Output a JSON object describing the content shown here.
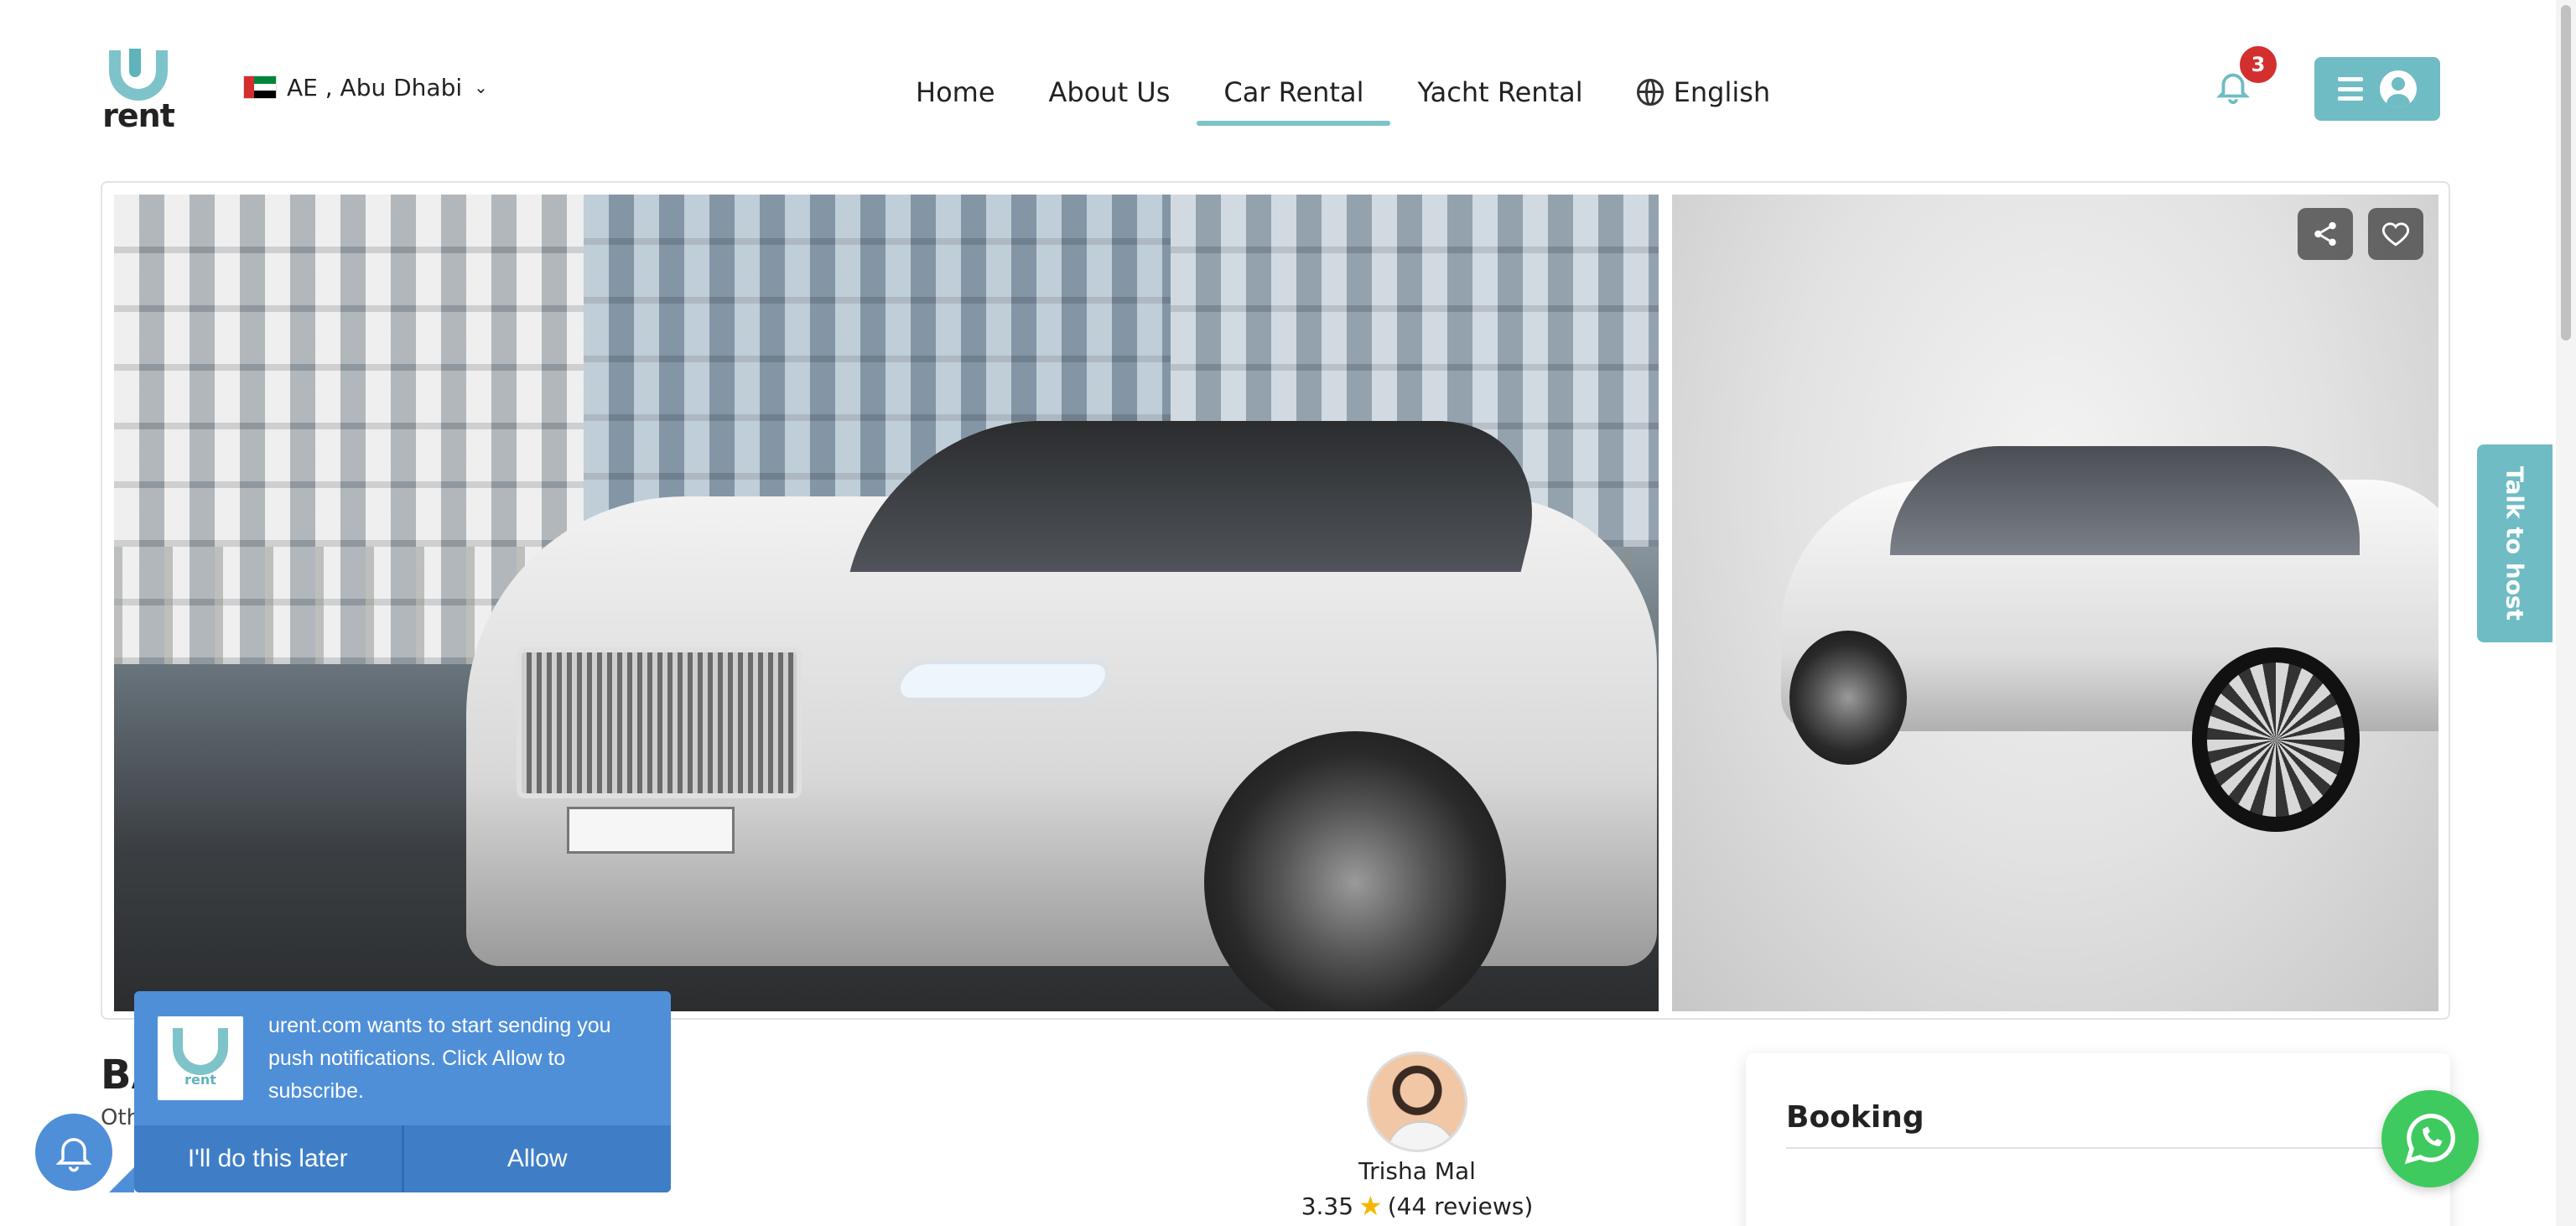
{
  "brand": {
    "logo_text": "rent"
  },
  "location": {
    "label": "AE , Abu Dhabi"
  },
  "nav": {
    "items": [
      {
        "label": "Home",
        "active": false
      },
      {
        "label": "About Us",
        "active": false
      },
      {
        "label": "Car Rental",
        "active": true
      },
      {
        "label": "Yacht Rental",
        "active": false
      }
    ],
    "language": "English"
  },
  "notifications": {
    "count": "3"
  },
  "colors": {
    "accent": "#6fbcc4",
    "badge": "#d32f2f",
    "push": "#4f8fd8",
    "whatsapp": "#3fca5f"
  },
  "gallery": {
    "share_icon": "share-icon",
    "favorite_icon": "heart-icon"
  },
  "talk_to_host": "Talk to host",
  "listing": {
    "title_fragment": "BA",
    "subtitle_fragment": "Oth"
  },
  "host": {
    "name": "Trisha Mal",
    "rating": "3.35",
    "reviews": "(44 reviews)"
  },
  "booking": {
    "title": "Booking"
  },
  "push_prompt": {
    "message": "urent.com wants to start sending you push notifications. Click Allow to subscribe.",
    "later": "I'll do this later",
    "allow": "Allow"
  }
}
